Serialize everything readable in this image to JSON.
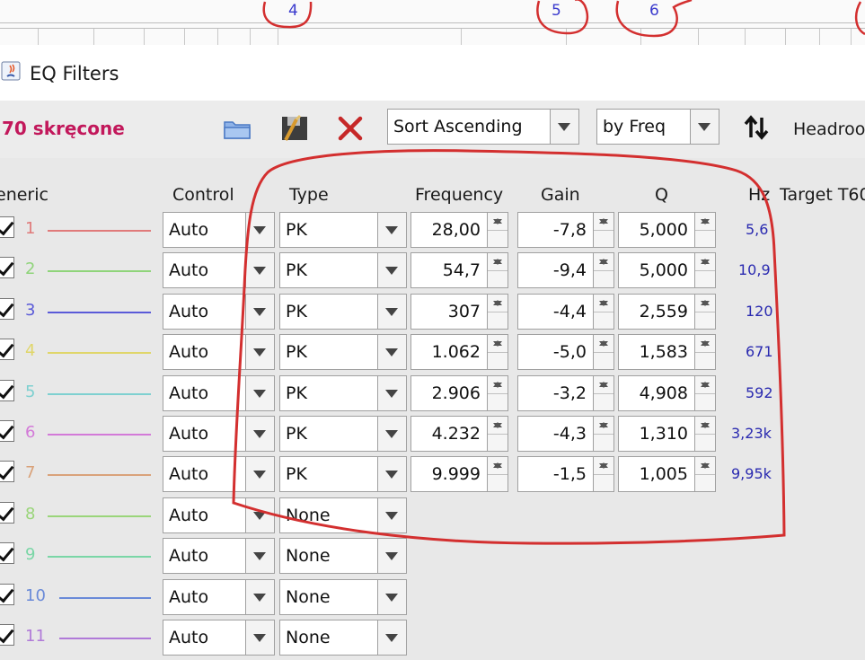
{
  "ruler": {
    "numbers": [
      "4",
      "5",
      "6"
    ]
  },
  "window": {
    "title": "EQ Filters"
  },
  "toolbar": {
    "preset_name": "70 skręcone",
    "sort_value": "Sort Ascending",
    "sort_by_value": "by Freq",
    "headroom_label": "Headroo"
  },
  "headers": {
    "generic": "eneric",
    "control": "Control",
    "type": "Type",
    "frequency": "Frequency",
    "gain": "Gain",
    "q": "Q",
    "hz": "Hz",
    "target": "Target T60"
  },
  "colors": {
    "preset": "#c2185b",
    "hz_text": "#2a2ab0",
    "annotation": "#d32f2f"
  },
  "filters": [
    {
      "index": "1",
      "color": "#e07a7a",
      "control": "Auto",
      "type": "PK",
      "frequency": "28,00",
      "gain": "-7,8",
      "q": "5,000",
      "hz": "5,6"
    },
    {
      "index": "2",
      "color": "#8fd47a",
      "control": "Auto",
      "type": "PK",
      "frequency": "54,7",
      "gain": "-9,4",
      "q": "5,000",
      "hz": "10,9"
    },
    {
      "index": "3",
      "color": "#5a5ad8",
      "control": "Auto",
      "type": "PK",
      "frequency": "307",
      "gain": "-4,4",
      "q": "2,559",
      "hz": "120"
    },
    {
      "index": "4",
      "color": "#e0d66a",
      "control": "Auto",
      "type": "PK",
      "frequency": "1.062",
      "gain": "-5,0",
      "q": "1,583",
      "hz": "671"
    },
    {
      "index": "5",
      "color": "#7ed0d0",
      "control": "Auto",
      "type": "PK",
      "frequency": "2.906",
      "gain": "-3,2",
      "q": "4,908",
      "hz": "592"
    },
    {
      "index": "6",
      "color": "#d37ad8",
      "control": "Auto",
      "type": "PK",
      "frequency": "4.232",
      "gain": "-4,3",
      "q": "1,310",
      "hz": "3,23k"
    },
    {
      "index": "7",
      "color": "#d9a27a",
      "control": "Auto",
      "type": "PK",
      "frequency": "9.999",
      "gain": "-1,5",
      "q": "1,005",
      "hz": "9,95k"
    },
    {
      "index": "8",
      "color": "#9ad57a",
      "control": "Auto",
      "type": "None"
    },
    {
      "index": "9",
      "color": "#7ad6a6",
      "control": "Auto",
      "type": "None"
    },
    {
      "index": "10",
      "color": "#6a8ad8",
      "control": "Auto",
      "type": "None"
    },
    {
      "index": "11",
      "color": "#b07ad8",
      "control": "Auto",
      "type": "None"
    }
  ]
}
